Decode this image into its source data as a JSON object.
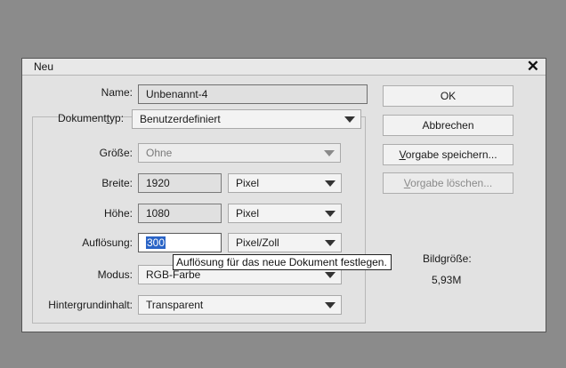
{
  "dialog": {
    "title": "Neu",
    "close_symbol": "✕",
    "close_icon": "close-icon"
  },
  "name": {
    "label": "Name:",
    "value": "Unbenannt-4"
  },
  "document_type": {
    "label_pre": "Dokument",
    "label_u": "t",
    "label_post": "yp:",
    "value": "Benutzerdefiniert"
  },
  "size": {
    "label": "Größe:",
    "value": "Ohne"
  },
  "width": {
    "label": "Breite:",
    "value": "1920",
    "unit": "Pixel"
  },
  "height": {
    "label": "Höhe:",
    "value": "1080",
    "unit": "Pixel"
  },
  "resolution": {
    "label": "Auflösung:",
    "value": "300",
    "unit": "Pixel/Zoll"
  },
  "mode": {
    "label": "Modus:",
    "value": "RGB-Farbe"
  },
  "background": {
    "label": "Hintergrundinhalt:",
    "value": "Transparent"
  },
  "buttons": {
    "ok": "OK",
    "cancel": "Abbrechen",
    "save_preset_u": "V",
    "save_preset_rest": "orgabe speichern...",
    "delete_preset_u": "V",
    "delete_preset_rest": "orgabe löschen..."
  },
  "image_size": {
    "label": "Bildgröße:",
    "value": "5,93M"
  },
  "tooltip": "Auflösung für das neue Dokument festlegen.",
  "icons": {
    "dropdown": "chevron-down-icon"
  }
}
